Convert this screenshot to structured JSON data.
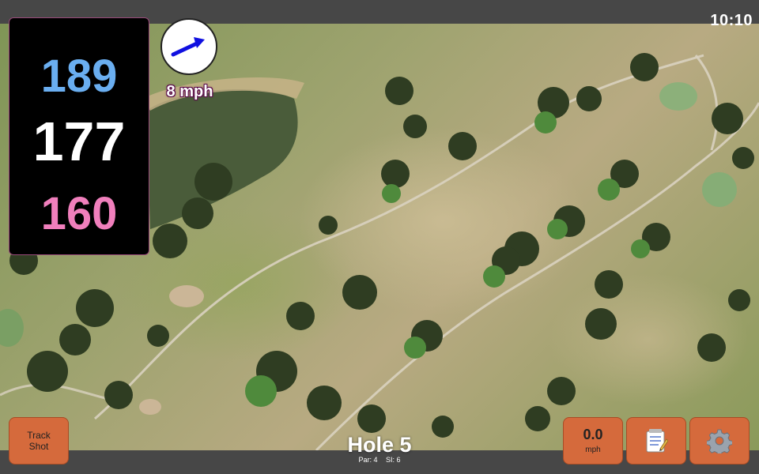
{
  "status_bar": {
    "time": "10:10"
  },
  "distances": {
    "back": "189",
    "middle": "177",
    "front": "160"
  },
  "wind": {
    "speed": "8 mph",
    "icon": "wind-direction-arrow-icon"
  },
  "hole": {
    "title": "Hole 5",
    "par": "Par: 4",
    "stroke_index": "SI: 6"
  },
  "buttons": {
    "track_shot_line1": "Track",
    "track_shot_line2": "Shot",
    "speed_value": "0.0",
    "speed_unit": "mph",
    "notes_icon": "notepad-icon",
    "settings_icon": "gear-icon"
  },
  "colors": {
    "back": "#6aaef0",
    "middle": "#ffffff",
    "front": "#f07fbc",
    "button": "#d56a3c",
    "bar": "#474747"
  }
}
